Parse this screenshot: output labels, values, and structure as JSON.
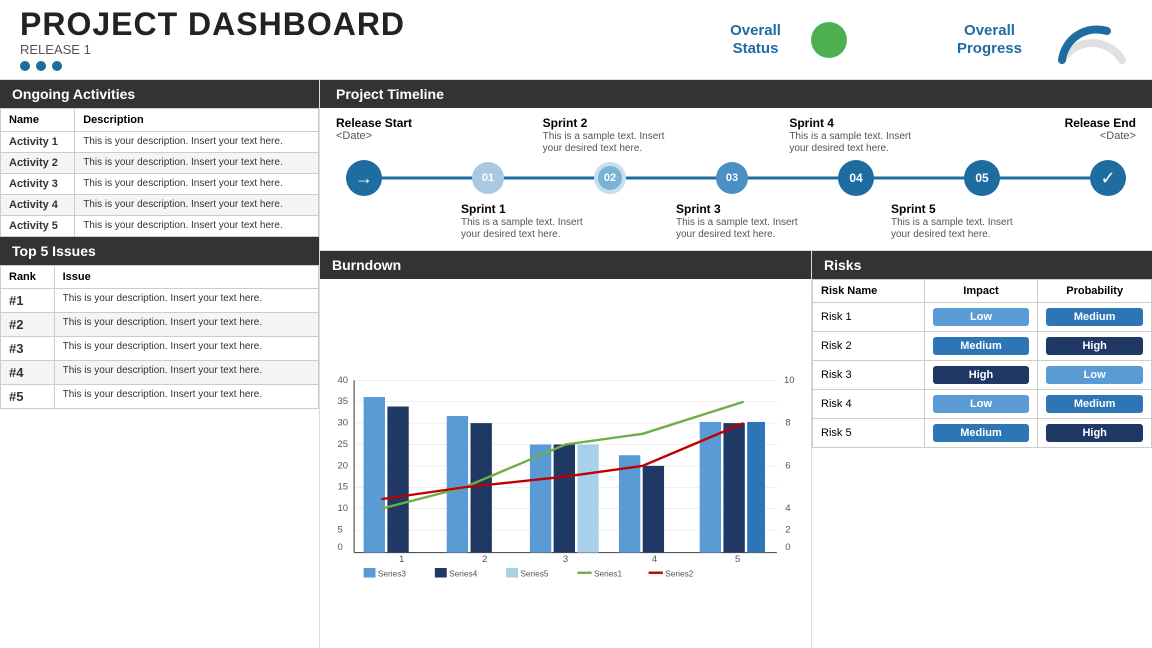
{
  "header": {
    "title": "PROJECT DASHBOARD",
    "subtitle": "RELEASE 1",
    "overall_status_label": "Overall\nStatus",
    "overall_progress_label": "Overall\nProgress"
  },
  "ongoing_activities": {
    "section_title": "Ongoing Activities",
    "col_name": "Name",
    "col_description": "Description",
    "rows": [
      {
        "name": "Activity 1",
        "description": "This is your description. Insert your text here."
      },
      {
        "name": "Activity 2",
        "description": "This is your description. Insert your text here."
      },
      {
        "name": "Activity 3",
        "description": "This is your description. Insert your text here."
      },
      {
        "name": "Activity 4",
        "description": "This is your description. Insert your text here."
      },
      {
        "name": "Activity 5",
        "description": "This is your description. Insert your text here."
      }
    ]
  },
  "top5_issues": {
    "section_title": "Top 5 Issues",
    "col_rank": "Rank",
    "col_issue": "Issue",
    "rows": [
      {
        "rank": "#1",
        "issue": "This is your description. Insert your text here."
      },
      {
        "rank": "#2",
        "issue": "This is your description. Insert your text here."
      },
      {
        "rank": "#3",
        "issue": "This is your description. Insert your text here."
      },
      {
        "rank": "#4",
        "issue": "This is your description. Insert your text here."
      },
      {
        "rank": "#5",
        "issue": "This is your description. Insert your text here."
      }
    ]
  },
  "project_timeline": {
    "section_title": "Project Timeline",
    "nodes": [
      {
        "id": "start",
        "label": "→",
        "top_title": "Release Start",
        "top_sub": "<Date>",
        "bottom_title": "",
        "bottom_sub": ""
      },
      {
        "id": "01",
        "label": "01",
        "top_title": "",
        "top_sub": "",
        "bottom_title": "Sprint 1",
        "bottom_sub": "This is a sample text. Insert your desired text here."
      },
      {
        "id": "02",
        "label": "02",
        "top_title": "Sprint 2",
        "top_sub": "This is a sample text. Insert your desired text here.",
        "bottom_title": "",
        "bottom_sub": ""
      },
      {
        "id": "03",
        "label": "03",
        "top_title": "",
        "top_sub": "",
        "bottom_title": "Sprint 3",
        "bottom_sub": "This is a sample text. Insert your desired text here."
      },
      {
        "id": "04",
        "label": "04",
        "top_title": "Sprint 4",
        "top_sub": "This is a sample text. Insert your desired text here.",
        "bottom_title": "",
        "bottom_sub": ""
      },
      {
        "id": "05",
        "label": "05",
        "top_title": "",
        "top_sub": "",
        "bottom_title": "Sprint 5",
        "bottom_sub": "This is a sample text. Insert your desired text here."
      },
      {
        "id": "end",
        "label": "✓",
        "top_title": "Release End",
        "top_sub": "<Date>",
        "bottom_title": "",
        "bottom_sub": ""
      }
    ]
  },
  "burndown": {
    "section_title": "Burndown",
    "y_left_max": 40,
    "y_right_max": 10,
    "legend": [
      "Series3",
      "Series4",
      "Series5",
      "Series1",
      "Series2"
    ]
  },
  "risks": {
    "section_title": "Risks",
    "col_name": "Risk Name",
    "col_impact": "Impact",
    "col_probability": "Probability",
    "rows": [
      {
        "name": "Risk 1",
        "impact": "Low",
        "impact_style": "badge-low",
        "probability": "Medium",
        "prob_style": "badge-medium"
      },
      {
        "name": "Risk 2",
        "impact": "Medium",
        "impact_style": "badge-medium",
        "probability": "High",
        "prob_style": "badge-high-dark"
      },
      {
        "name": "Risk 3",
        "impact": "High",
        "impact_style": "badge-high-dark",
        "probability": "Low",
        "prob_style": "badge-low"
      },
      {
        "name": "Risk 4",
        "impact": "Low",
        "impact_style": "badge-low",
        "probability": "Medium",
        "prob_style": "badge-medium"
      },
      {
        "name": "Risk 5",
        "impact": "Medium",
        "impact_style": "badge-medium",
        "probability": "High",
        "prob_style": "badge-high-dark"
      }
    ]
  }
}
